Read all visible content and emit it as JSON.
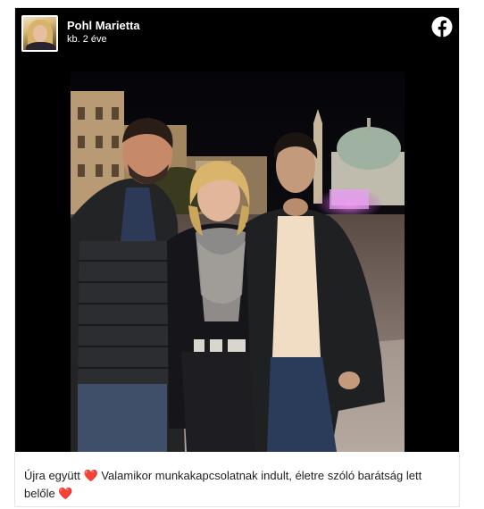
{
  "post": {
    "author_name": "Pohl Marietta",
    "timestamp": "kb. 2 éve",
    "caption_part1": "Újra együtt",
    "caption_part2": "Valamikor munkakapcsolatnak indult, életre szóló barátság lett belőle",
    "heart_emoji": "❤️"
  },
  "icons": {
    "brand": "facebook-logo-icon",
    "emoji": "red-heart-icon"
  },
  "colors": {
    "media_background": "#000000",
    "brand_icon": "#ffffff",
    "heart": "#e02424",
    "text": "#1c1e21"
  }
}
